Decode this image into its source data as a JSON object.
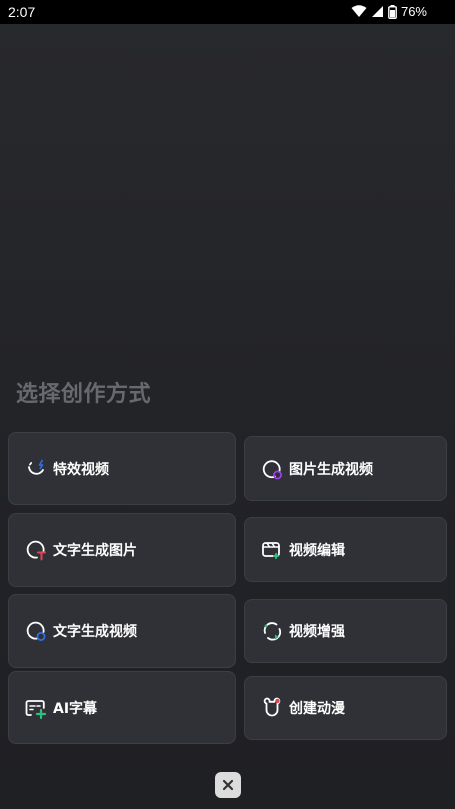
{
  "status_bar": {
    "time": "2:07",
    "battery": "76%",
    "icons": [
      "wifi-icon",
      "cellular-signal-icon",
      "battery-icon"
    ]
  },
  "heading": "选择创作方式",
  "cards": {
    "effects_video": {
      "label": "特效视频",
      "icon": "effects-video-icon"
    },
    "image_to_video": {
      "label": "图片生成视频",
      "icon": "image-to-video-icon"
    },
    "text_to_image": {
      "label": "文字生成图片",
      "icon": "text-to-image-icon"
    },
    "video_edit": {
      "label": "视频编辑",
      "icon": "video-edit-icon"
    },
    "text_to_video": {
      "label": "文字生成视频",
      "icon": "text-to-video-icon"
    },
    "video_enhance": {
      "label": "视频增强",
      "icon": "video-enhance-icon"
    },
    "ai_subtitles": {
      "label": "AI字幕",
      "icon": "ai-subtitles-icon"
    },
    "create_anime": {
      "label": "创建动漫",
      "icon": "create-anime-icon"
    }
  },
  "close_button": {
    "icon": "close-icon"
  },
  "colors": {
    "background": "#202125",
    "card": "#303136",
    "heading": "#68696e",
    "accent_blue": "#2f6fe8",
    "accent_red": "#e04555",
    "accent_purple": "#9b40e8",
    "accent_green": "#2ec07a"
  }
}
